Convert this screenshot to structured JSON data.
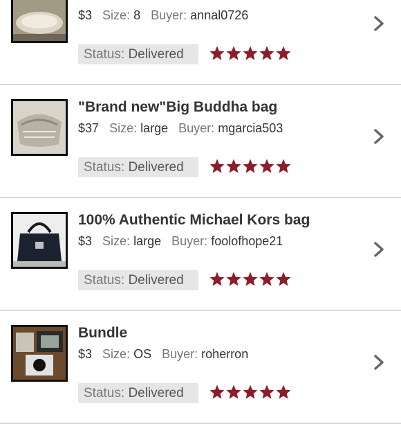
{
  "listings": [
    {
      "title": "",
      "price": "$3",
      "size_label": "Size:",
      "size": "8",
      "buyer_label": "Buyer:",
      "buyer": "annal0726",
      "status_label": "Status:",
      "status": "Delivered",
      "rating": 5,
      "thumb_icon": "shoes-photo"
    },
    {
      "title": "\"Brand new\"Big Buddha bag",
      "price": "$37",
      "size_label": "Size:",
      "size": "large",
      "buyer_label": "Buyer:",
      "buyer": "mgarcia503",
      "status_label": "Status:",
      "status": "Delivered",
      "rating": 5,
      "thumb_icon": "silver-bag-photo"
    },
    {
      "title": "100% Authentic Michael Kors bag",
      "price": "$3",
      "size_label": "Size:",
      "size": "large",
      "buyer_label": "Buyer:",
      "buyer": "foolofhope21",
      "status_label": "Status:",
      "status": "Delivered",
      "rating": 5,
      "thumb_icon": "black-handbag-photo"
    },
    {
      "title": "Bundle",
      "price": "$3",
      "size_label": "Size:",
      "size": "OS",
      "buyer_label": "Buyer:",
      "buyer": "roherron",
      "status_label": "Status:",
      "status": "Delivered",
      "rating": 5,
      "thumb_icon": "bundle-photo"
    }
  ],
  "colors": {
    "star": "#8b1e2b",
    "chevron": "#666666",
    "status_bg": "#e6e6e6",
    "divider": "#d9d9d9"
  }
}
